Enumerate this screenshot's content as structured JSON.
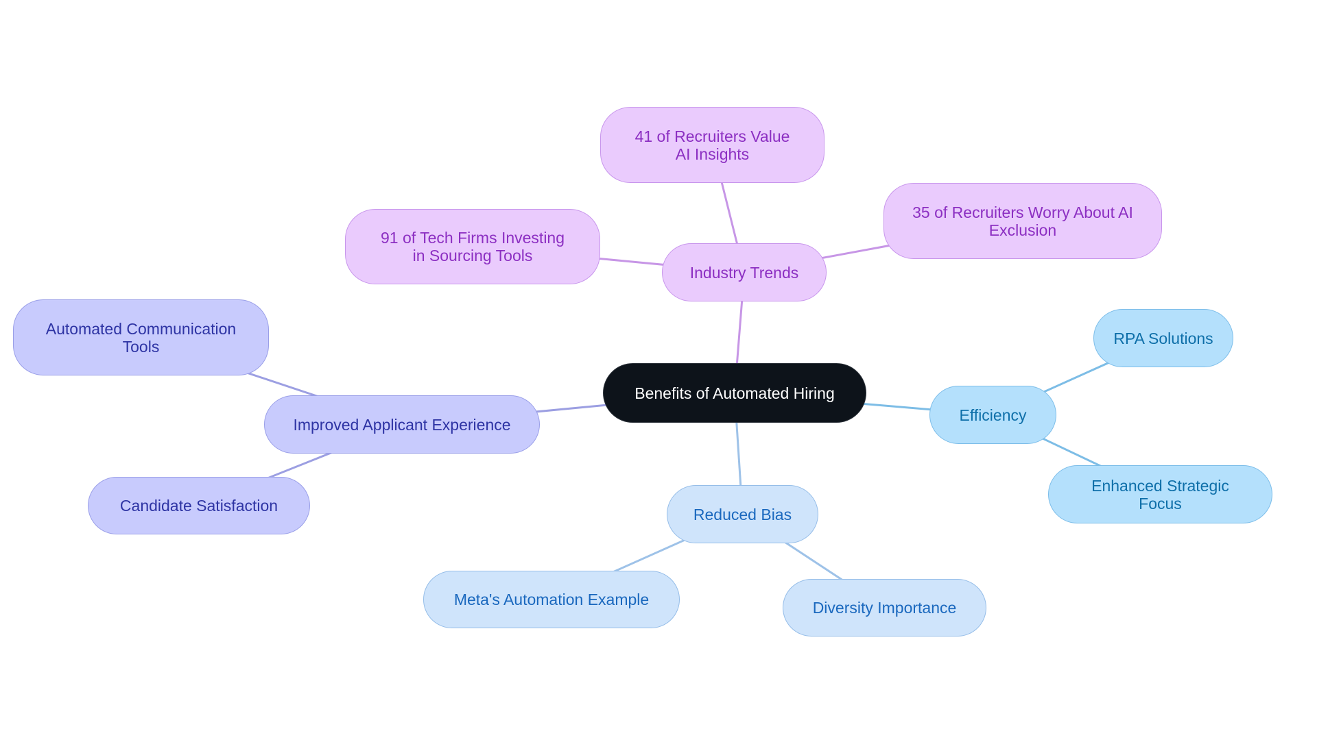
{
  "title": "Benefits of Automated Hiring",
  "colors": {
    "root": "#0d131a",
    "industry_trends": "#eacbfd",
    "improved_applicant_experience": "#c8cbfd",
    "efficiency": "#b4e0fc",
    "reduced_bias": "#cfe4fb"
  },
  "nodes": {
    "root": "Benefits of Automated Hiring",
    "industry_trends": "Industry Trends",
    "it_1": "41 of Recruiters Value AI Insights",
    "it_2": "91 of Tech Firms Investing in Sourcing Tools",
    "it_3": "35 of Recruiters Worry About AI Exclusion",
    "improved_applicant_experience": "Improved Applicant Experience",
    "iae_1": "Automated Communication Tools",
    "iae_2": "Candidate Satisfaction",
    "efficiency": "Efficiency",
    "eff_1": "RPA Solutions",
    "eff_2": "Enhanced Strategic Focus",
    "reduced_bias": "Reduced Bias",
    "rb_1": "Meta's Automation Example",
    "rb_2": "Diversity Importance"
  },
  "edges": [
    [
      "root",
      "industry_trends"
    ],
    [
      "industry_trends",
      "it_1"
    ],
    [
      "industry_trends",
      "it_2"
    ],
    [
      "industry_trends",
      "it_3"
    ],
    [
      "root",
      "improved_applicant_experience"
    ],
    [
      "improved_applicant_experience",
      "iae_1"
    ],
    [
      "improved_applicant_experience",
      "iae_2"
    ],
    [
      "root",
      "efficiency"
    ],
    [
      "efficiency",
      "eff_1"
    ],
    [
      "efficiency",
      "eff_2"
    ],
    [
      "root",
      "reduced_bias"
    ],
    [
      "reduced_bias",
      "rb_1"
    ],
    [
      "reduced_bias",
      "rb_2"
    ]
  ]
}
